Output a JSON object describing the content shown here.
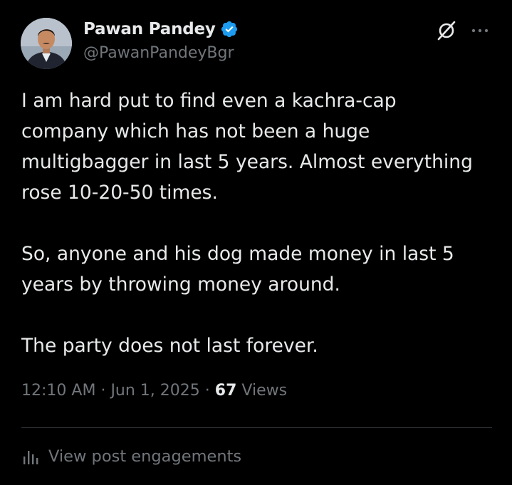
{
  "author": {
    "display_name": "Pawan Pandey",
    "handle": "@PawanPandeyBgr",
    "verified": true,
    "verified_color": "#1d9bf0"
  },
  "icons": {
    "verified": "verified-badge-icon",
    "grok": "grok-slash-icon",
    "more": "more-horizontal-icon",
    "engagements": "bar-chart-icon"
  },
  "post": {
    "paragraphs": [
      "I am hard put to find even a kachra-cap\ncompany which has not been a huge\nmultigbagger in last 5 years. Almost everything\nrose 10-20-50 times.",
      "So, anyone and his dog made money in last 5\nyears by throwing money around.",
      "The party does not last forever."
    ]
  },
  "meta": {
    "time": "12:10 AM",
    "separator": "·",
    "date": "Jun 1, 2025",
    "views_count": "67",
    "views_label": "Views"
  },
  "actions": {
    "engagements_label": "View post engagements"
  },
  "colors": {
    "background": "#000000",
    "primary_text": "#e7e9ea",
    "secondary_text": "#71767b",
    "divider": "#2f3336"
  }
}
